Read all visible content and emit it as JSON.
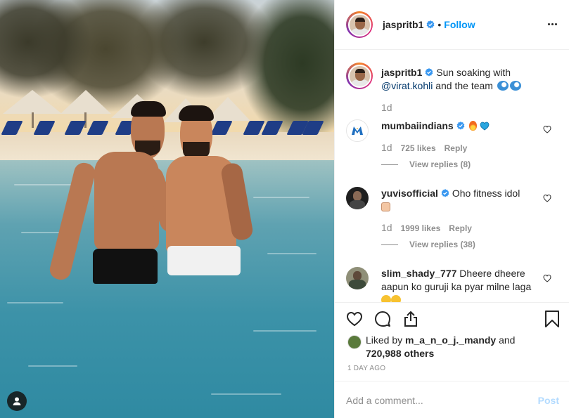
{
  "post": {
    "author": "jaspritb1",
    "follow_label": "Follow",
    "separator": "•",
    "caption": {
      "username": "jaspritb1",
      "text_before": " Sun soaking with ",
      "mention": "@virat.kohli",
      "text_after": " and the team ",
      "time": "1d"
    }
  },
  "comments": [
    {
      "username": "mumbaiindians",
      "text": "",
      "time": "1d",
      "likes": "725 likes",
      "reply_label": "Reply",
      "view_replies": "View replies (8)"
    },
    {
      "username": "yuvisofficial",
      "text": "Oho fitness idol",
      "time": "1d",
      "likes": "1999 likes",
      "reply_label": "Reply",
      "view_replies": "View replies (38)"
    },
    {
      "username": "slim_shady_777",
      "text": "Dheere dheere aapun ko guruji ka pyar milne laga"
    }
  ],
  "likes": {
    "prefix": "Liked by ",
    "liker": "m_a_n_o_j._mandy",
    "and": " and",
    "count": "720,988 others"
  },
  "date": "1 DAY AGO",
  "add_comment": {
    "placeholder": "Add a comment...",
    "post_label": "Post"
  },
  "colors": {
    "link_blue": "#0095f6",
    "verified_blue": "#3897f0",
    "muted": "#8e8e8e"
  },
  "icons": [
    "more-icon",
    "verified-icon",
    "heart-icon",
    "comment-icon",
    "share-icon",
    "bookmark-icon",
    "tag-user-icon"
  ]
}
